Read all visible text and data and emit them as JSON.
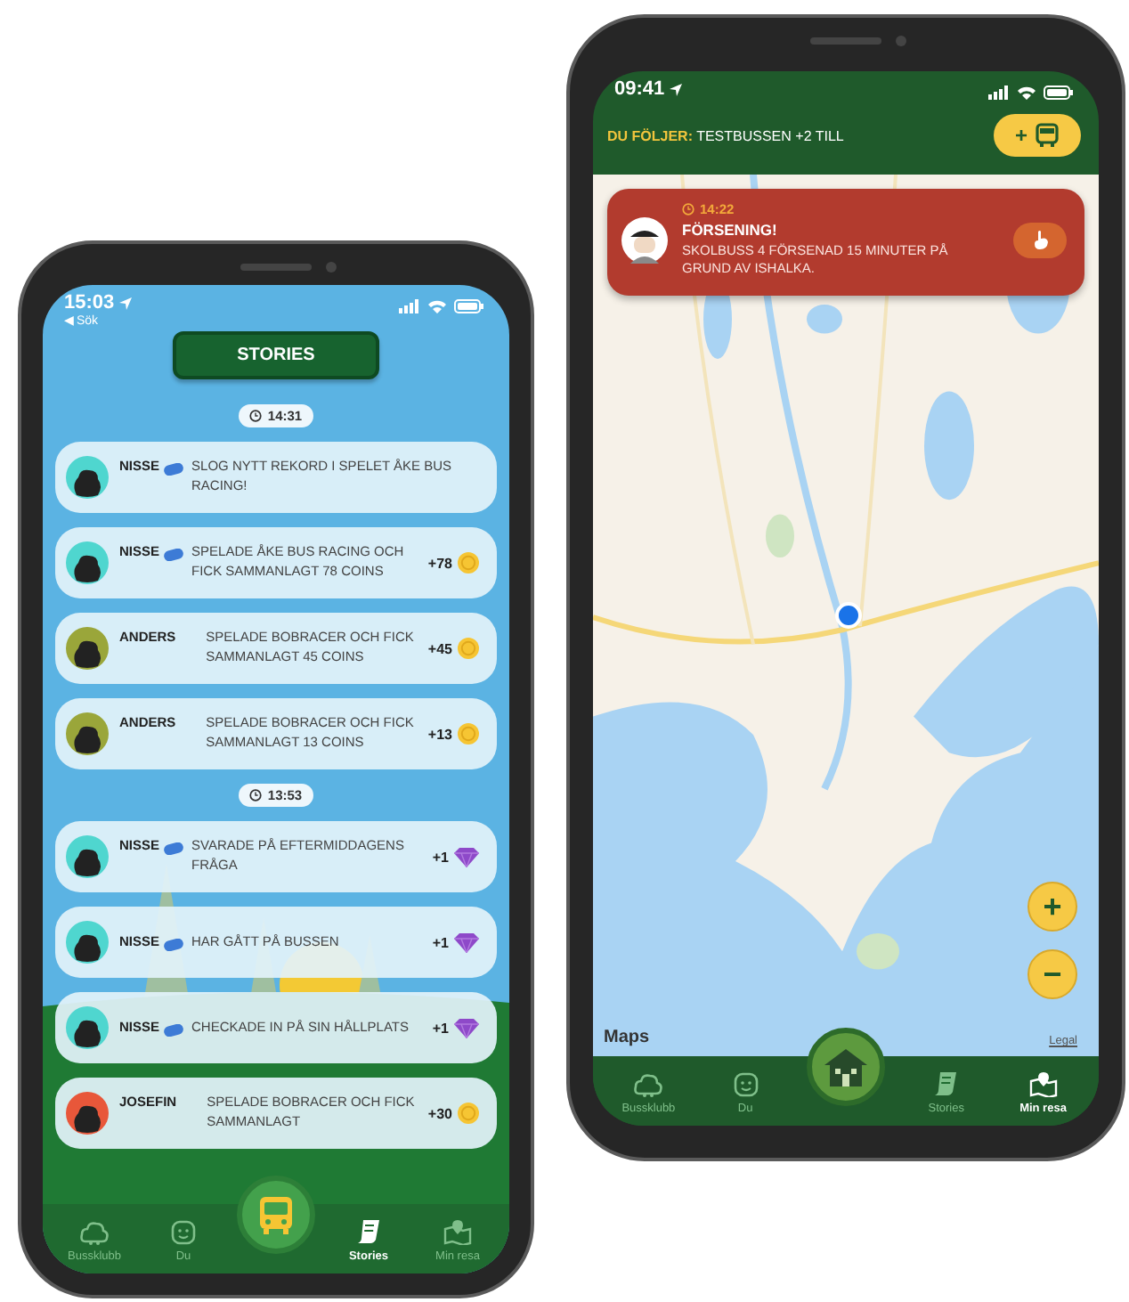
{
  "stories_screen": {
    "status_bar": {
      "time": "15:03",
      "back": "◀ Sök"
    },
    "title": "STORIES",
    "feed": [
      {
        "kind": "time",
        "time": "14:31"
      },
      {
        "kind": "story",
        "name": "NISSE",
        "badge": true,
        "color": "#4fd6cf",
        "text": "SLOG NYTT REKORD I SPELET ÅKE BUS RACING!"
      },
      {
        "kind": "story",
        "name": "NISSE",
        "badge": true,
        "color": "#4fd6cf",
        "text": "SPELADE ÅKE BUS RACING OCH FICK SAMMANLAGT 78 COINS",
        "reward": {
          "amount": "+78",
          "kind": "coin"
        }
      },
      {
        "kind": "story",
        "name": "ANDERS",
        "badge": false,
        "color": "#9aa63a",
        "text": "SPELADE BOBRACER OCH FICK SAMMANLAGT 45 COINS",
        "reward": {
          "amount": "+45",
          "kind": "coin"
        }
      },
      {
        "kind": "story",
        "name": "ANDERS",
        "badge": false,
        "color": "#9aa63a",
        "text": "SPELADE BOBRACER OCH FICK SAMMANLAGT 13 COINS",
        "reward": {
          "amount": "+13",
          "kind": "coin"
        }
      },
      {
        "kind": "time",
        "time": "13:53"
      },
      {
        "kind": "story",
        "name": "NISSE",
        "badge": true,
        "color": "#4fd6cf",
        "text": "SVARADE PÅ EFTERMIDDAGENS FRÅGA",
        "reward": {
          "amount": "+1",
          "kind": "gem"
        }
      },
      {
        "kind": "story",
        "name": "NISSE",
        "badge": true,
        "color": "#4fd6cf",
        "text": "HAR GÅTT PÅ BUSSEN",
        "reward": {
          "amount": "+1",
          "kind": "gem"
        }
      },
      {
        "kind": "story",
        "name": "NISSE",
        "badge": true,
        "color": "#4fd6cf",
        "text": "CHECKADE IN PÅ SIN HÅLLPLATS",
        "reward": {
          "amount": "+1",
          "kind": "gem"
        }
      },
      {
        "kind": "story",
        "name": "JOSEFIN",
        "badge": false,
        "color": "#e8573a",
        "text": "SPELADE BOBRACER OCH FICK SAMMANLAGT",
        "reward": {
          "amount": "+30",
          "kind": "coin"
        }
      }
    ],
    "nav": [
      {
        "label": "Bussklubb",
        "selected": false
      },
      {
        "label": "Du",
        "selected": false
      },
      {
        "label": "Stories",
        "selected": true
      },
      {
        "label": "Min resa",
        "selected": false
      }
    ]
  },
  "map_screen": {
    "status_bar": {
      "time": "09:41"
    },
    "following": {
      "label": "DU FÖLJER:",
      "value": "TESTBUSSEN +2 TILL"
    },
    "add_button": "+",
    "alert": {
      "time": "14:22",
      "title": "FÖRSENING!",
      "message": "SKOLBUSS 4 FÖRSENAD 15 MINUTER PÅ GRUND AV ISHALKA."
    },
    "zoom_in": "+",
    "zoom_out": "−",
    "attribution": "Maps",
    "legal": "Legal",
    "nav": [
      {
        "label": "Bussklubb",
        "selected": false
      },
      {
        "label": "Du",
        "selected": false
      },
      {
        "label": "Stories",
        "selected": false
      },
      {
        "label": "Min resa",
        "selected": true
      }
    ]
  }
}
